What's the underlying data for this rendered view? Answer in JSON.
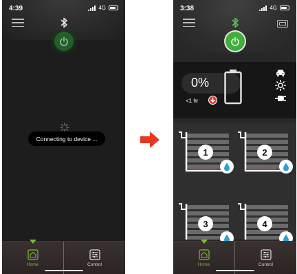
{
  "left_screen": {
    "status_time": "4:39",
    "network": "4G",
    "toast": "Connecting to device ...",
    "tabs": [
      {
        "label": "Home"
      },
      {
        "label": "Control"
      }
    ]
  },
  "right_screen": {
    "status_time": "3:38",
    "network": "4G",
    "charge_percent": "0%",
    "time_remaining": "<1 hr",
    "slots": [
      {
        "number": "1"
      },
      {
        "number": "2"
      },
      {
        "number": "3"
      },
      {
        "number": "4"
      }
    ],
    "tabs": [
      {
        "label": "Home"
      },
      {
        "label": "Control"
      }
    ]
  },
  "colors": {
    "accent_green": "#7dbb3a",
    "power_green": "#3fae3a",
    "arrow_red": "#e8361f",
    "down_red": "#e53935",
    "drop_blue": "#2a9fd8"
  },
  "icons": [
    "menu-icon",
    "bluetooth-icon",
    "power-icon",
    "device-icon",
    "spinner-icon",
    "car-icon",
    "sun-icon",
    "plug-icon",
    "battery-icon",
    "water-drop-icon",
    "home-icon",
    "sliders-icon",
    "arrow-right-icon"
  ]
}
